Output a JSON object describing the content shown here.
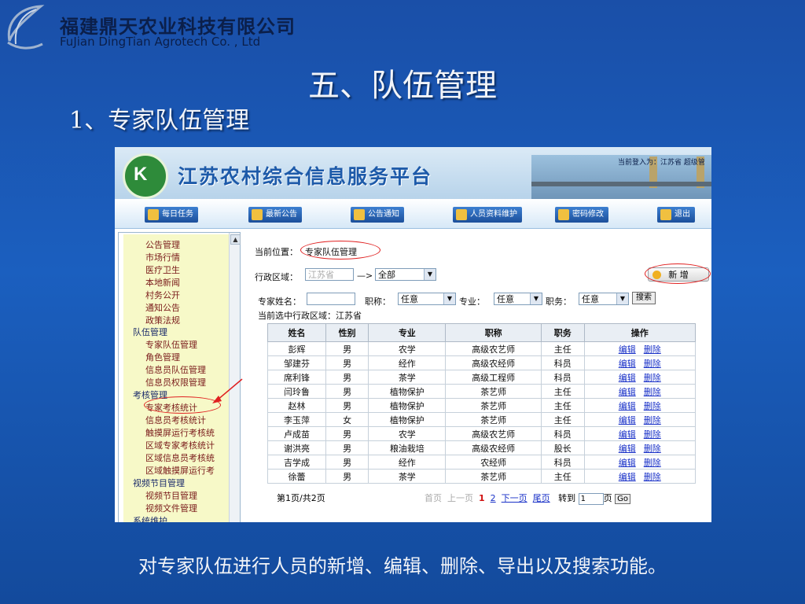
{
  "slide": {
    "company_cn": "福建鼎天农业科技有限公司",
    "company_en": "FuJian DingTian Agrotech Co. , Ltd",
    "title": "五、队伍管理",
    "subtitle": "1、专家队伍管理",
    "caption": "对专家队伍进行人员的新增、编辑、删除、导出以及搜索功能。"
  },
  "app": {
    "title": "江苏农村综合信息服务平台",
    "login_info": "当前登入为：江苏省 超级管",
    "nav": [
      "每日任务",
      "最新公告",
      "公告通知",
      "人员资料维护",
      "密码修改",
      "退出"
    ]
  },
  "sidebar": {
    "items": [
      "公告管理",
      "市场行情",
      "医疗卫生",
      "本地新闻",
      "村务公开",
      "通知公告",
      "政策法规",
      "队伍管理",
      "专家队伍管理",
      "角色管理",
      "信息员队伍管理",
      "信息员权限管理",
      "考核管理",
      "专家考核统计",
      "信息员考核统计",
      "触摸屏运行考核统",
      "区域专家考核统计",
      "区域信息员考核统",
      "区域触摸屏运行考",
      "视频节目管理",
      "视频节目管理",
      "视频文件管理",
      "系统维护"
    ]
  },
  "main": {
    "breadcrumb_label": "当前位置：",
    "breadcrumb_value": "专家队伍管理",
    "region_label": "行政区域：",
    "region_input": "江苏省",
    "region_arrow": "—>",
    "region_select": "全部",
    "new_button": "新 增",
    "name_label": "专家姓名：",
    "title_label": "职称：",
    "title_value": "任意",
    "major_label": "专业：",
    "major_value": "任意",
    "post_label": "职务：",
    "post_value": "任意",
    "search_button": "搜索",
    "current_region": "当前选中行政区域：江苏省"
  },
  "table": {
    "headers": [
      "姓名",
      "性别",
      "专业",
      "职称",
      "职务",
      "操作"
    ],
    "edit_label": "编辑",
    "delete_label": "删除",
    "rows": [
      [
        "彭辉",
        "男",
        "农学",
        "高级农艺师",
        "主任"
      ],
      [
        "邹建芬",
        "男",
        "经作",
        "高级农经师",
        "科员"
      ],
      [
        "席利锋",
        "男",
        "茶学",
        "高级工程师",
        "科员"
      ],
      [
        "闫玲鲁",
        "男",
        "植物保护",
        "茶艺师",
        "主任"
      ],
      [
        "赵林",
        "男",
        "植物保护",
        "茶艺师",
        "主任"
      ],
      [
        "李玉萍",
        "女",
        "植物保护",
        "茶艺师",
        "主任"
      ],
      [
        "卢成苗",
        "男",
        "农学",
        "高级农艺师",
        "科员"
      ],
      [
        "谢洪亮",
        "男",
        "粮油栽培",
        "高级农经师",
        "股长"
      ],
      [
        "吉学成",
        "男",
        "经作",
        "农经师",
        "科员"
      ],
      [
        "徐蕾",
        "男",
        "茶学",
        "茶艺师",
        "主任"
      ]
    ]
  },
  "pager": {
    "summary": "第1页/共2页",
    "first": "首页",
    "prev": "上一页",
    "page1": "1",
    "page2": "2",
    "next": "下一页",
    "last": "尾页",
    "goto_label": "转到",
    "goto_value": "1",
    "page_suffix": "页",
    "go_button": "Go"
  },
  "colors": {
    "slide_bg": "#1b5fbf",
    "highlight": "#e02020",
    "link": "#1a32c8"
  }
}
